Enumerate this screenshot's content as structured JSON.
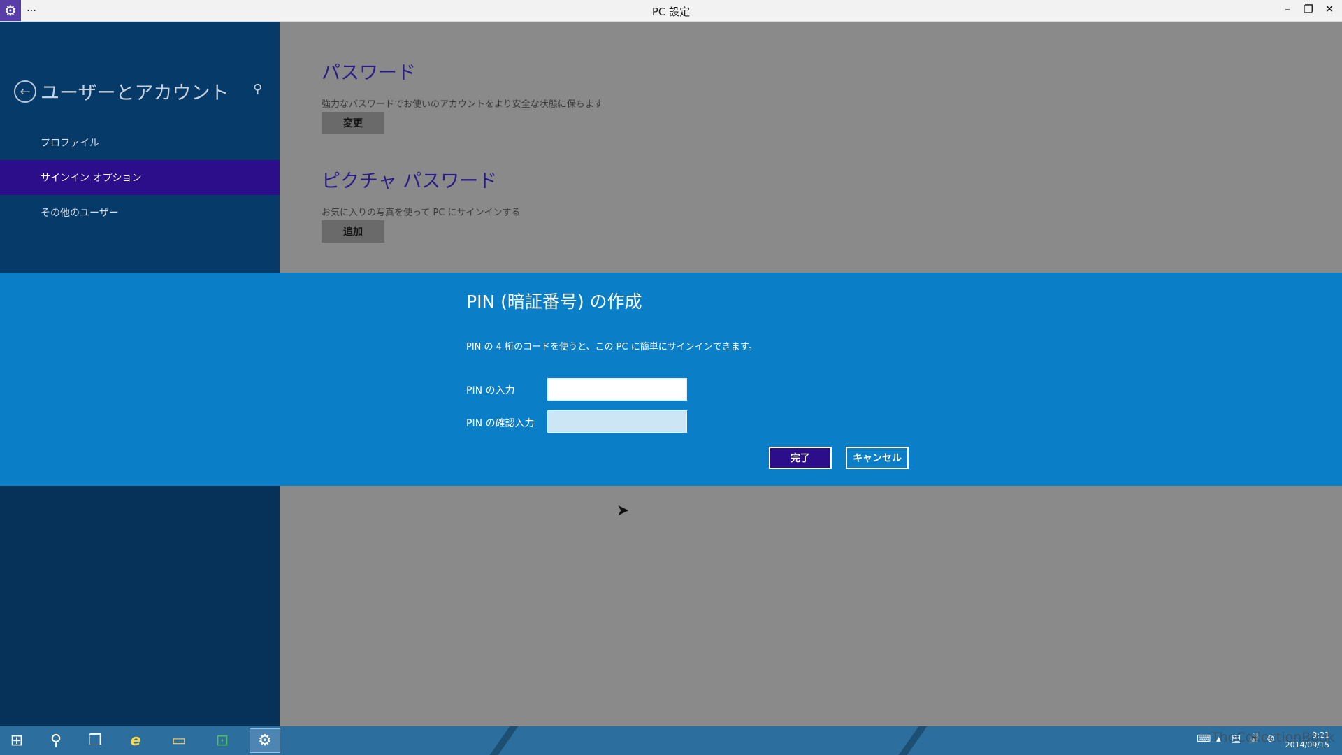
{
  "window": {
    "title": "PC 設定",
    "menu_glyph": "…",
    "controls": {
      "minimize": "–",
      "restore": "❐",
      "close": "✕"
    }
  },
  "sidebar": {
    "back_icon": "←",
    "heading": "ユーザーとアカウント",
    "search_icon": "⚲",
    "items": [
      {
        "label": "プロファイル"
      },
      {
        "label": "サインイン オプション"
      },
      {
        "label": "その他のユーザー"
      }
    ]
  },
  "main": {
    "sections": [
      {
        "title": "パスワード",
        "description": "強力なパスワードでお使いのアカウントをより安全な状態に保ちます",
        "button": "変更"
      },
      {
        "title": "ピクチャ パスワード",
        "description": "お気に入りの写真を使って PC にサインインする",
        "button": "追加"
      }
    ]
  },
  "dialog": {
    "title": "PIN (暗証番号) の作成",
    "description": "PIN の 4 桁のコードを使うと、この PC に簡単にサインインできます。",
    "pin_label": "PIN の入力",
    "pin_value": "",
    "confirm_label": "PIN の確認入力",
    "confirm_value": "",
    "ok_button": "完了",
    "cancel_button": "キャンセル"
  },
  "taskbar": {
    "start_icon": "⊞",
    "search_icon": "⚲",
    "task_view_icon": "❐",
    "ie_icon": "e",
    "explorer_icon": "▭",
    "store_icon": "⊡",
    "settings_icon": "⚙",
    "time": "9:21",
    "date": "2014/09/15",
    "watermark": "TheCollectionBook"
  },
  "colors": {
    "sidebar_bg": "#06325a",
    "active_item": "#2c0e8a",
    "dialog_bg": "#0a7fc7",
    "section_title": "#2a1e86"
  }
}
